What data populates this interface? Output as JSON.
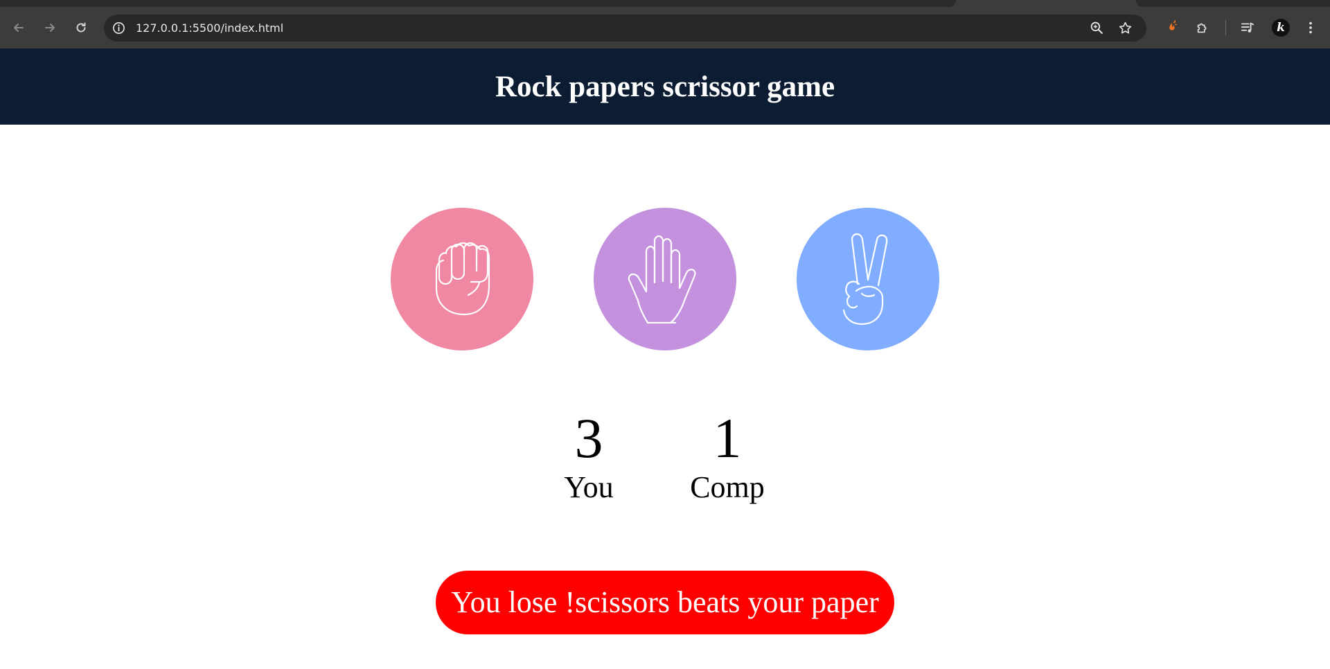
{
  "browser": {
    "url": "127.0.0.1:5500/index.html",
    "profile_initial": "k"
  },
  "header": {
    "title": "Rock papers scrissor game",
    "background": "#0b1c33"
  },
  "choices": [
    {
      "id": "rock",
      "icon": "fist-icon",
      "color": "#f088a3"
    },
    {
      "id": "paper",
      "icon": "open-hand-icon",
      "color": "#c391de"
    },
    {
      "id": "scissors",
      "icon": "peace-sign-icon",
      "color": "#80adff"
    }
  ],
  "score": {
    "user": {
      "value": "3",
      "label": "You"
    },
    "comp": {
      "value": "1",
      "label": "Comp"
    }
  },
  "message": {
    "text": "You lose !scissors beats your paper",
    "background": "#ff0000"
  }
}
